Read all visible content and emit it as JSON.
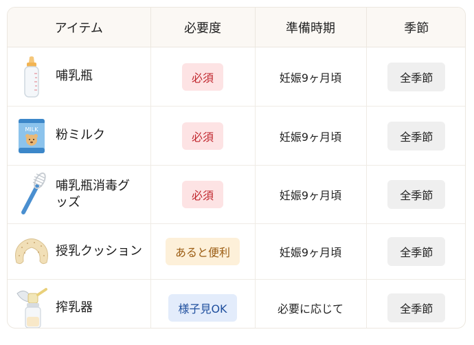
{
  "header": {
    "item": "アイテム",
    "necessity": "必要度",
    "timing": "準備時期",
    "season": "季節"
  },
  "rows": [
    {
      "name": "哺乳瓶",
      "necessity": "必須",
      "timing": "妊娠9ヶ月頃",
      "season": "全季節",
      "icon": "baby-bottle-icon"
    },
    {
      "name": "粉ミルク",
      "necessity": "必須",
      "timing": "妊娠9ヶ月頃",
      "season": "全季節",
      "icon": "formula-can-icon",
      "icon_text": "MILK"
    },
    {
      "name": "哺乳瓶消毒グッズ",
      "necessity": "必須",
      "timing": "妊娠9ヶ月頃",
      "season": "全季節",
      "icon": "bottle-brush-icon"
    },
    {
      "name": "授乳クッション",
      "necessity": "あると便利",
      "timing": "妊娠9ヶ月頃",
      "season": "全季節",
      "icon": "nursing-pillow-icon"
    },
    {
      "name": "搾乳器",
      "necessity": "様子見OK",
      "timing": "必要に応じて",
      "season": "全季節",
      "icon": "breast-pump-icon"
    }
  ],
  "colors": {
    "required": "#c0262d",
    "convenient": "#9b5c12",
    "wait_and_see": "#1f4f9e",
    "header_bg": "#fbf8f4"
  }
}
